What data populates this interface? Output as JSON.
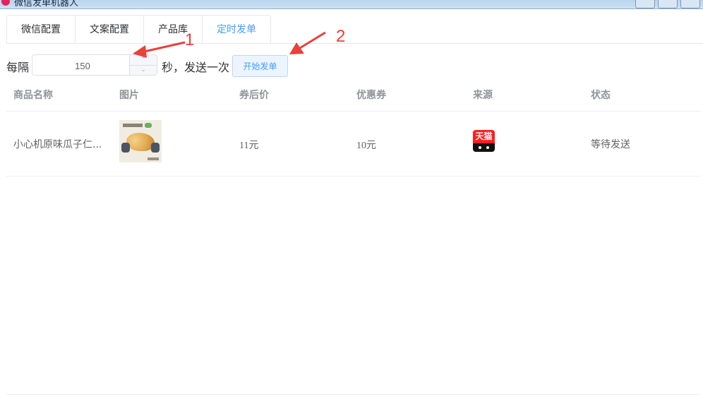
{
  "window": {
    "title": "微信发单机器人"
  },
  "tabs": [
    {
      "label": "微信配置",
      "active": false
    },
    {
      "label": "文案配置",
      "active": false
    },
    {
      "label": "产品库",
      "active": false
    },
    {
      "label": "定时发单",
      "active": true
    }
  ],
  "schedule": {
    "prefix_label": "每隔",
    "interval_value": "150",
    "suffix_label": "秒，发送一次",
    "start_button_label": "开始发单"
  },
  "table": {
    "columns": [
      "商品名称",
      "图片",
      "券后价",
      "优惠券",
      "来源",
      "状态"
    ],
    "rows": [
      {
        "name": "小心机原味瓜子仁...",
        "image": "sunflower-seeds-product-image",
        "price_after_coupon": "11元",
        "coupon": "10元",
        "source_icon": "tmall-icon",
        "source_icon_text": "天猫",
        "status": "等待发送"
      }
    ]
  },
  "annotations": {
    "marker_1": "1",
    "marker_2": "2",
    "color": "#e8413c"
  },
  "colors": {
    "accent": "#409eff",
    "tmall_red": "#ff1f1f"
  }
}
